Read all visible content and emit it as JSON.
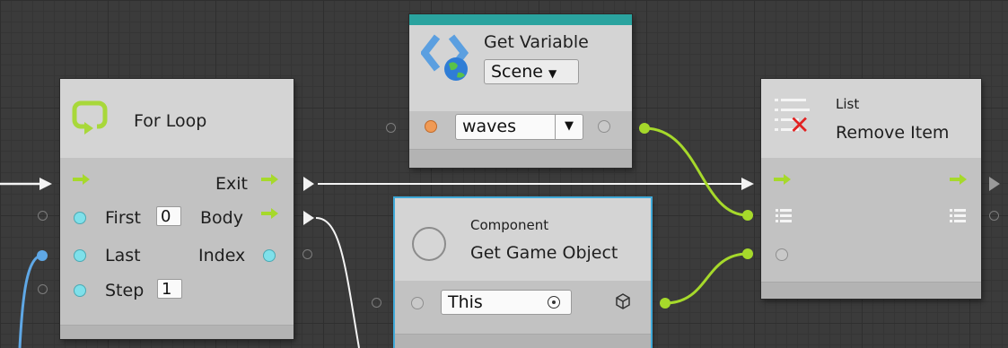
{
  "for_loop": {
    "title": "For Loop",
    "exit_label": "Exit",
    "body_label": "Body",
    "first_label": "First",
    "first_value": "0",
    "last_label": "Last",
    "step_label": "Step",
    "step_value": "1",
    "index_label": "Index"
  },
  "get_variable": {
    "title": "Get Variable",
    "scope": "Scene",
    "variable_name": "waves"
  },
  "get_game_object": {
    "category": "Component",
    "title": "Get Game Object",
    "target_value": "This"
  },
  "list_remove": {
    "category": "List",
    "title": "Remove Item"
  },
  "colors": {
    "background": "#3b3b3b",
    "node_body": "#c2c2c2",
    "flow_connection": "#ffffff",
    "value_connection": "#a6d92b",
    "int_port": "#7fe0ea",
    "variable_header": "#2aa39f",
    "selection_outline": "#3fa9d8"
  }
}
